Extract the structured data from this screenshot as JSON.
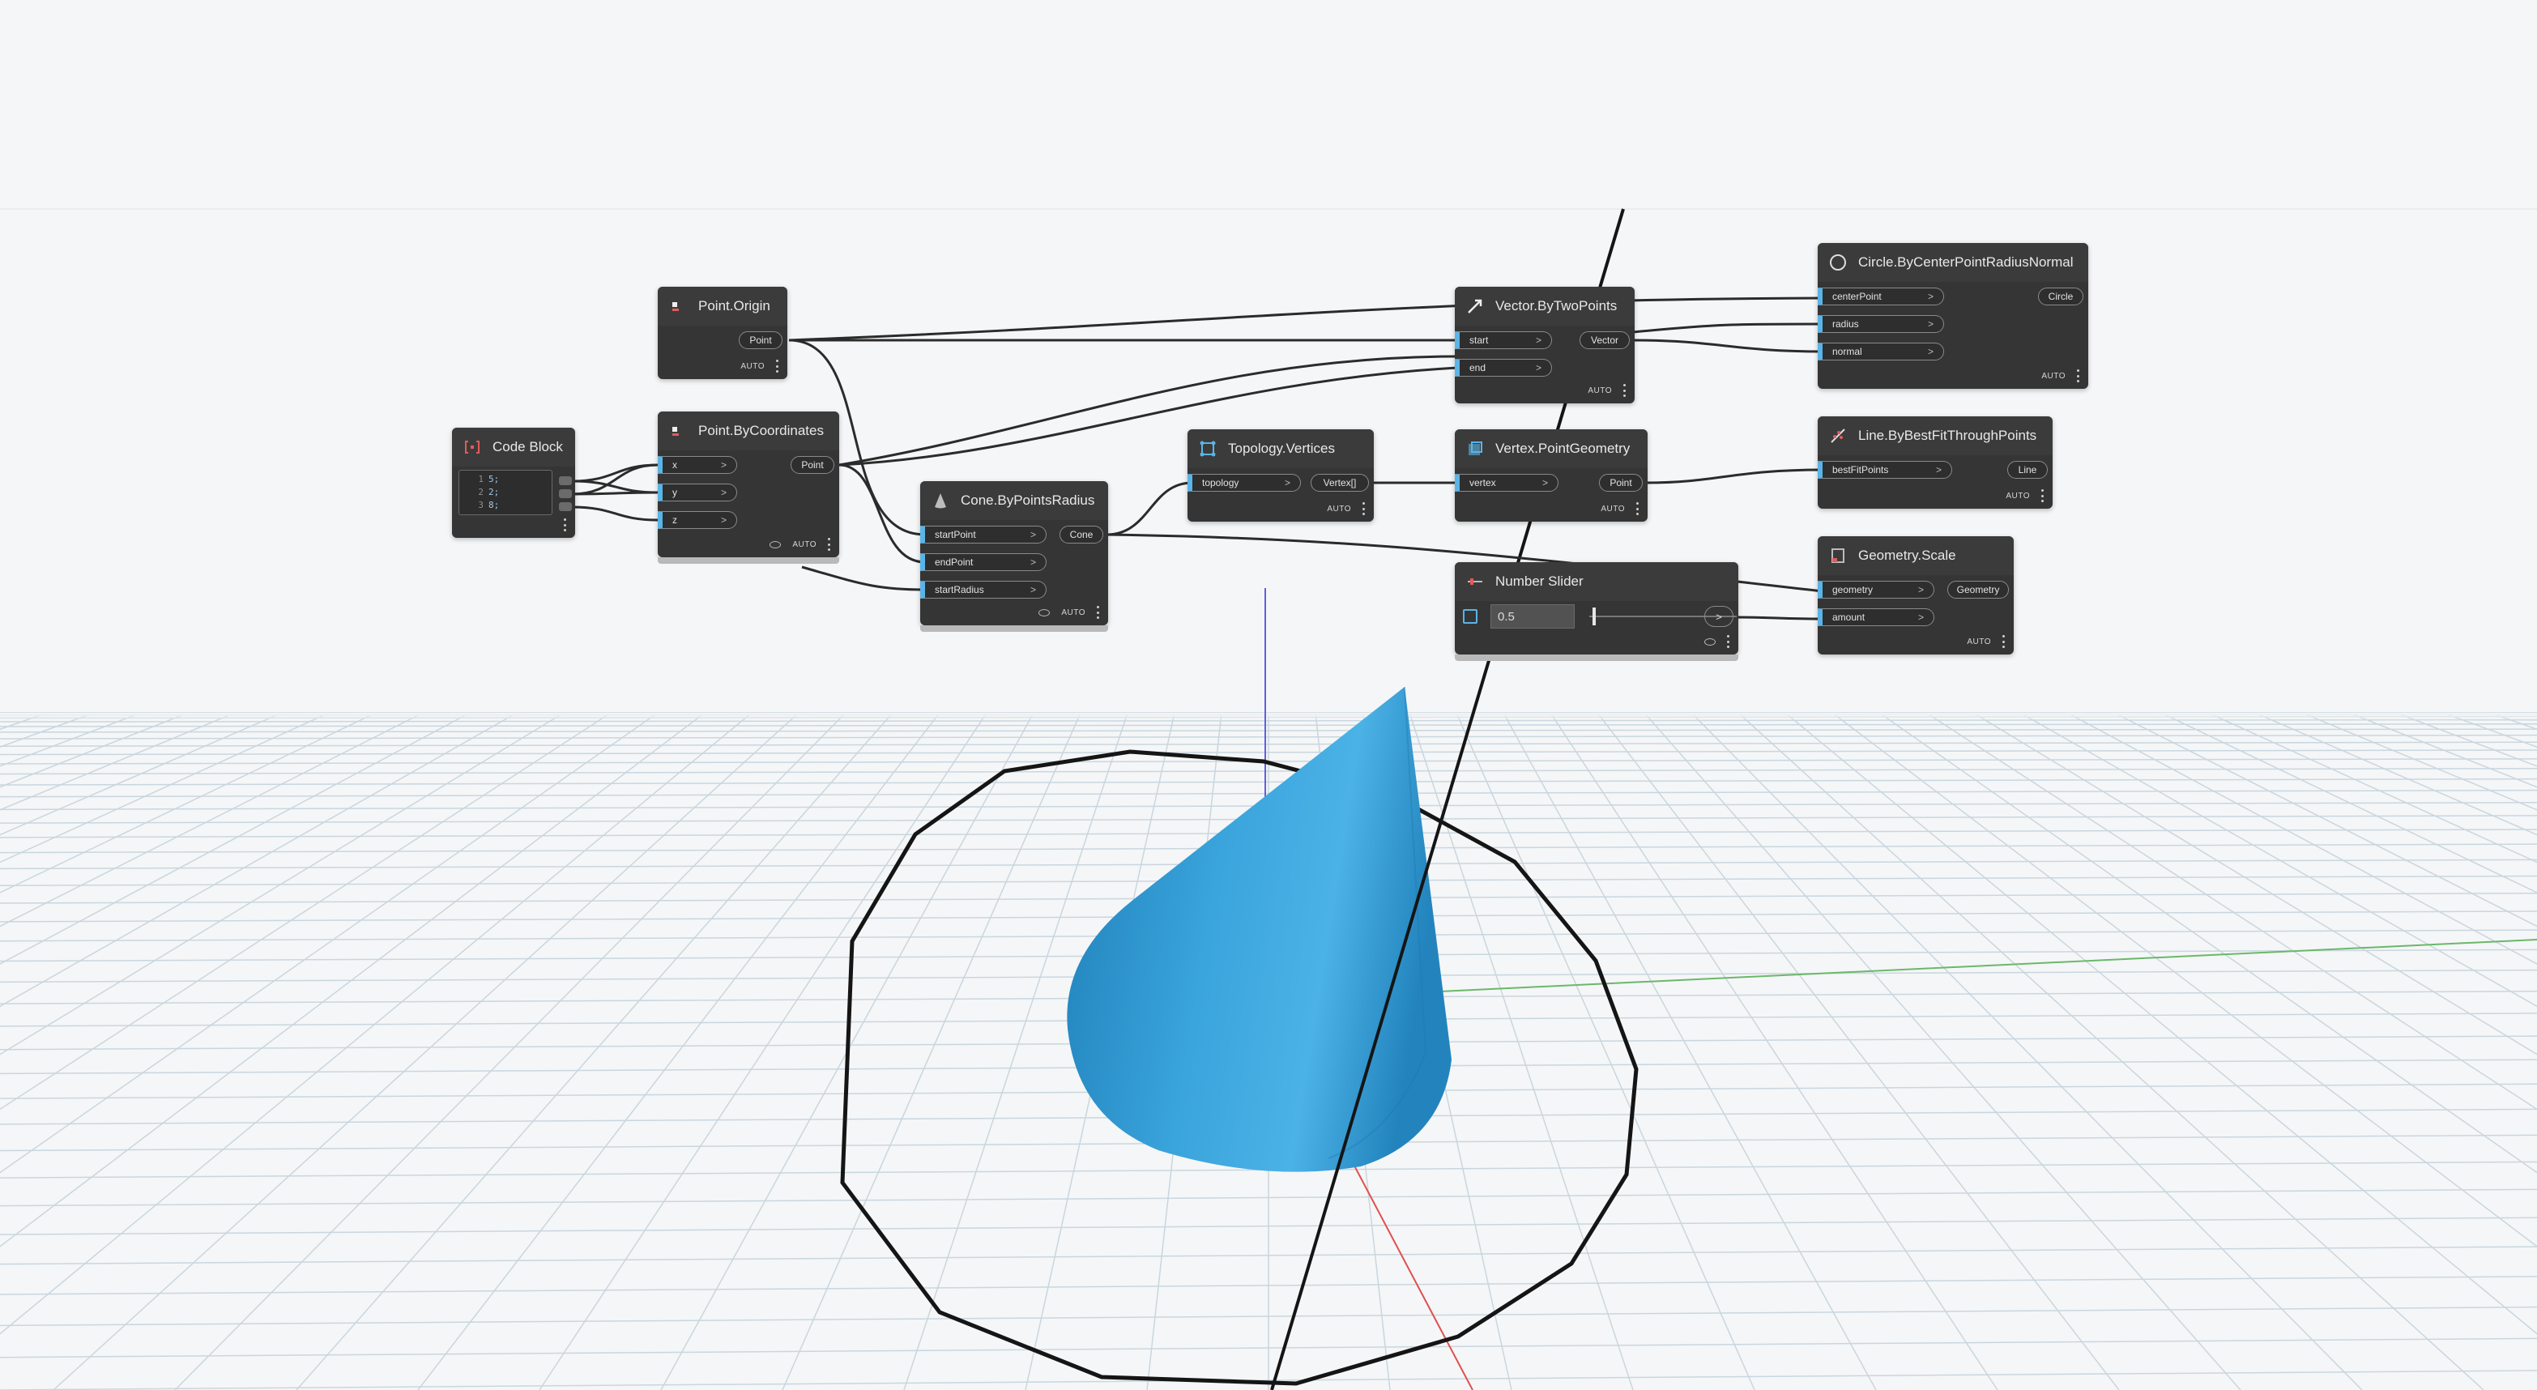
{
  "nodes": {
    "code_block": {
      "title": "Code Block",
      "lines": [
        {
          "num": "1",
          "text": "5;"
        },
        {
          "num": "2",
          "text": "2;"
        },
        {
          "num": "3",
          "text": "8;"
        }
      ]
    },
    "point_origin": {
      "title": "Point.Origin",
      "output": "Point",
      "lacing": "AUTO"
    },
    "point_by_coordinates": {
      "title": "Point.ByCoordinates",
      "inputs": [
        "x",
        "y",
        "z"
      ],
      "output": "Point",
      "lacing": "AUTO"
    },
    "cone_by_points_radius": {
      "title": "Cone.ByPointsRadius",
      "inputs": [
        "startPoint",
        "endPoint",
        "startRadius"
      ],
      "output": "Cone",
      "lacing": "AUTO"
    },
    "topology_vertices": {
      "title": "Topology.Vertices",
      "inputs": [
        "topology"
      ],
      "output": "Vertex[]",
      "lacing": "AUTO"
    },
    "vector_by_two_points": {
      "title": "Vector.ByTwoPoints",
      "inputs": [
        "start",
        "end"
      ],
      "output": "Vector",
      "lacing": "AUTO"
    },
    "vertex_point_geometry": {
      "title": "Vertex.PointGeometry",
      "inputs": [
        "vertex"
      ],
      "output": "Point",
      "lacing": "AUTO"
    },
    "number_slider": {
      "title": "Number Slider",
      "value": "0.5",
      "output": ">"
    },
    "circle_by_center": {
      "title": "Circle.ByCenterPointRadiusNormal",
      "inputs": [
        "centerPoint",
        "radius",
        "normal"
      ],
      "output": "Circle",
      "lacing": "AUTO"
    },
    "line_best_fit": {
      "title": "Line.ByBestFitThroughPoints",
      "inputs": [
        "bestFitPoints"
      ],
      "output": "Line",
      "lacing": "AUTO"
    },
    "geometry_scale": {
      "title": "Geometry.Scale",
      "inputs": [
        "geometry",
        "amount"
      ],
      "output": "Geometry",
      "lacing": "AUTO"
    }
  },
  "colors": {
    "node_body": "#353535",
    "input_port_accent": "#5ab4e6",
    "wire": "#2b2b2b",
    "cone": "#2a93cc",
    "grid": "#c9d6df",
    "axis_x": "#e05050",
    "axis_y": "#6ab86a",
    "axis_z": "#6060e0"
  }
}
